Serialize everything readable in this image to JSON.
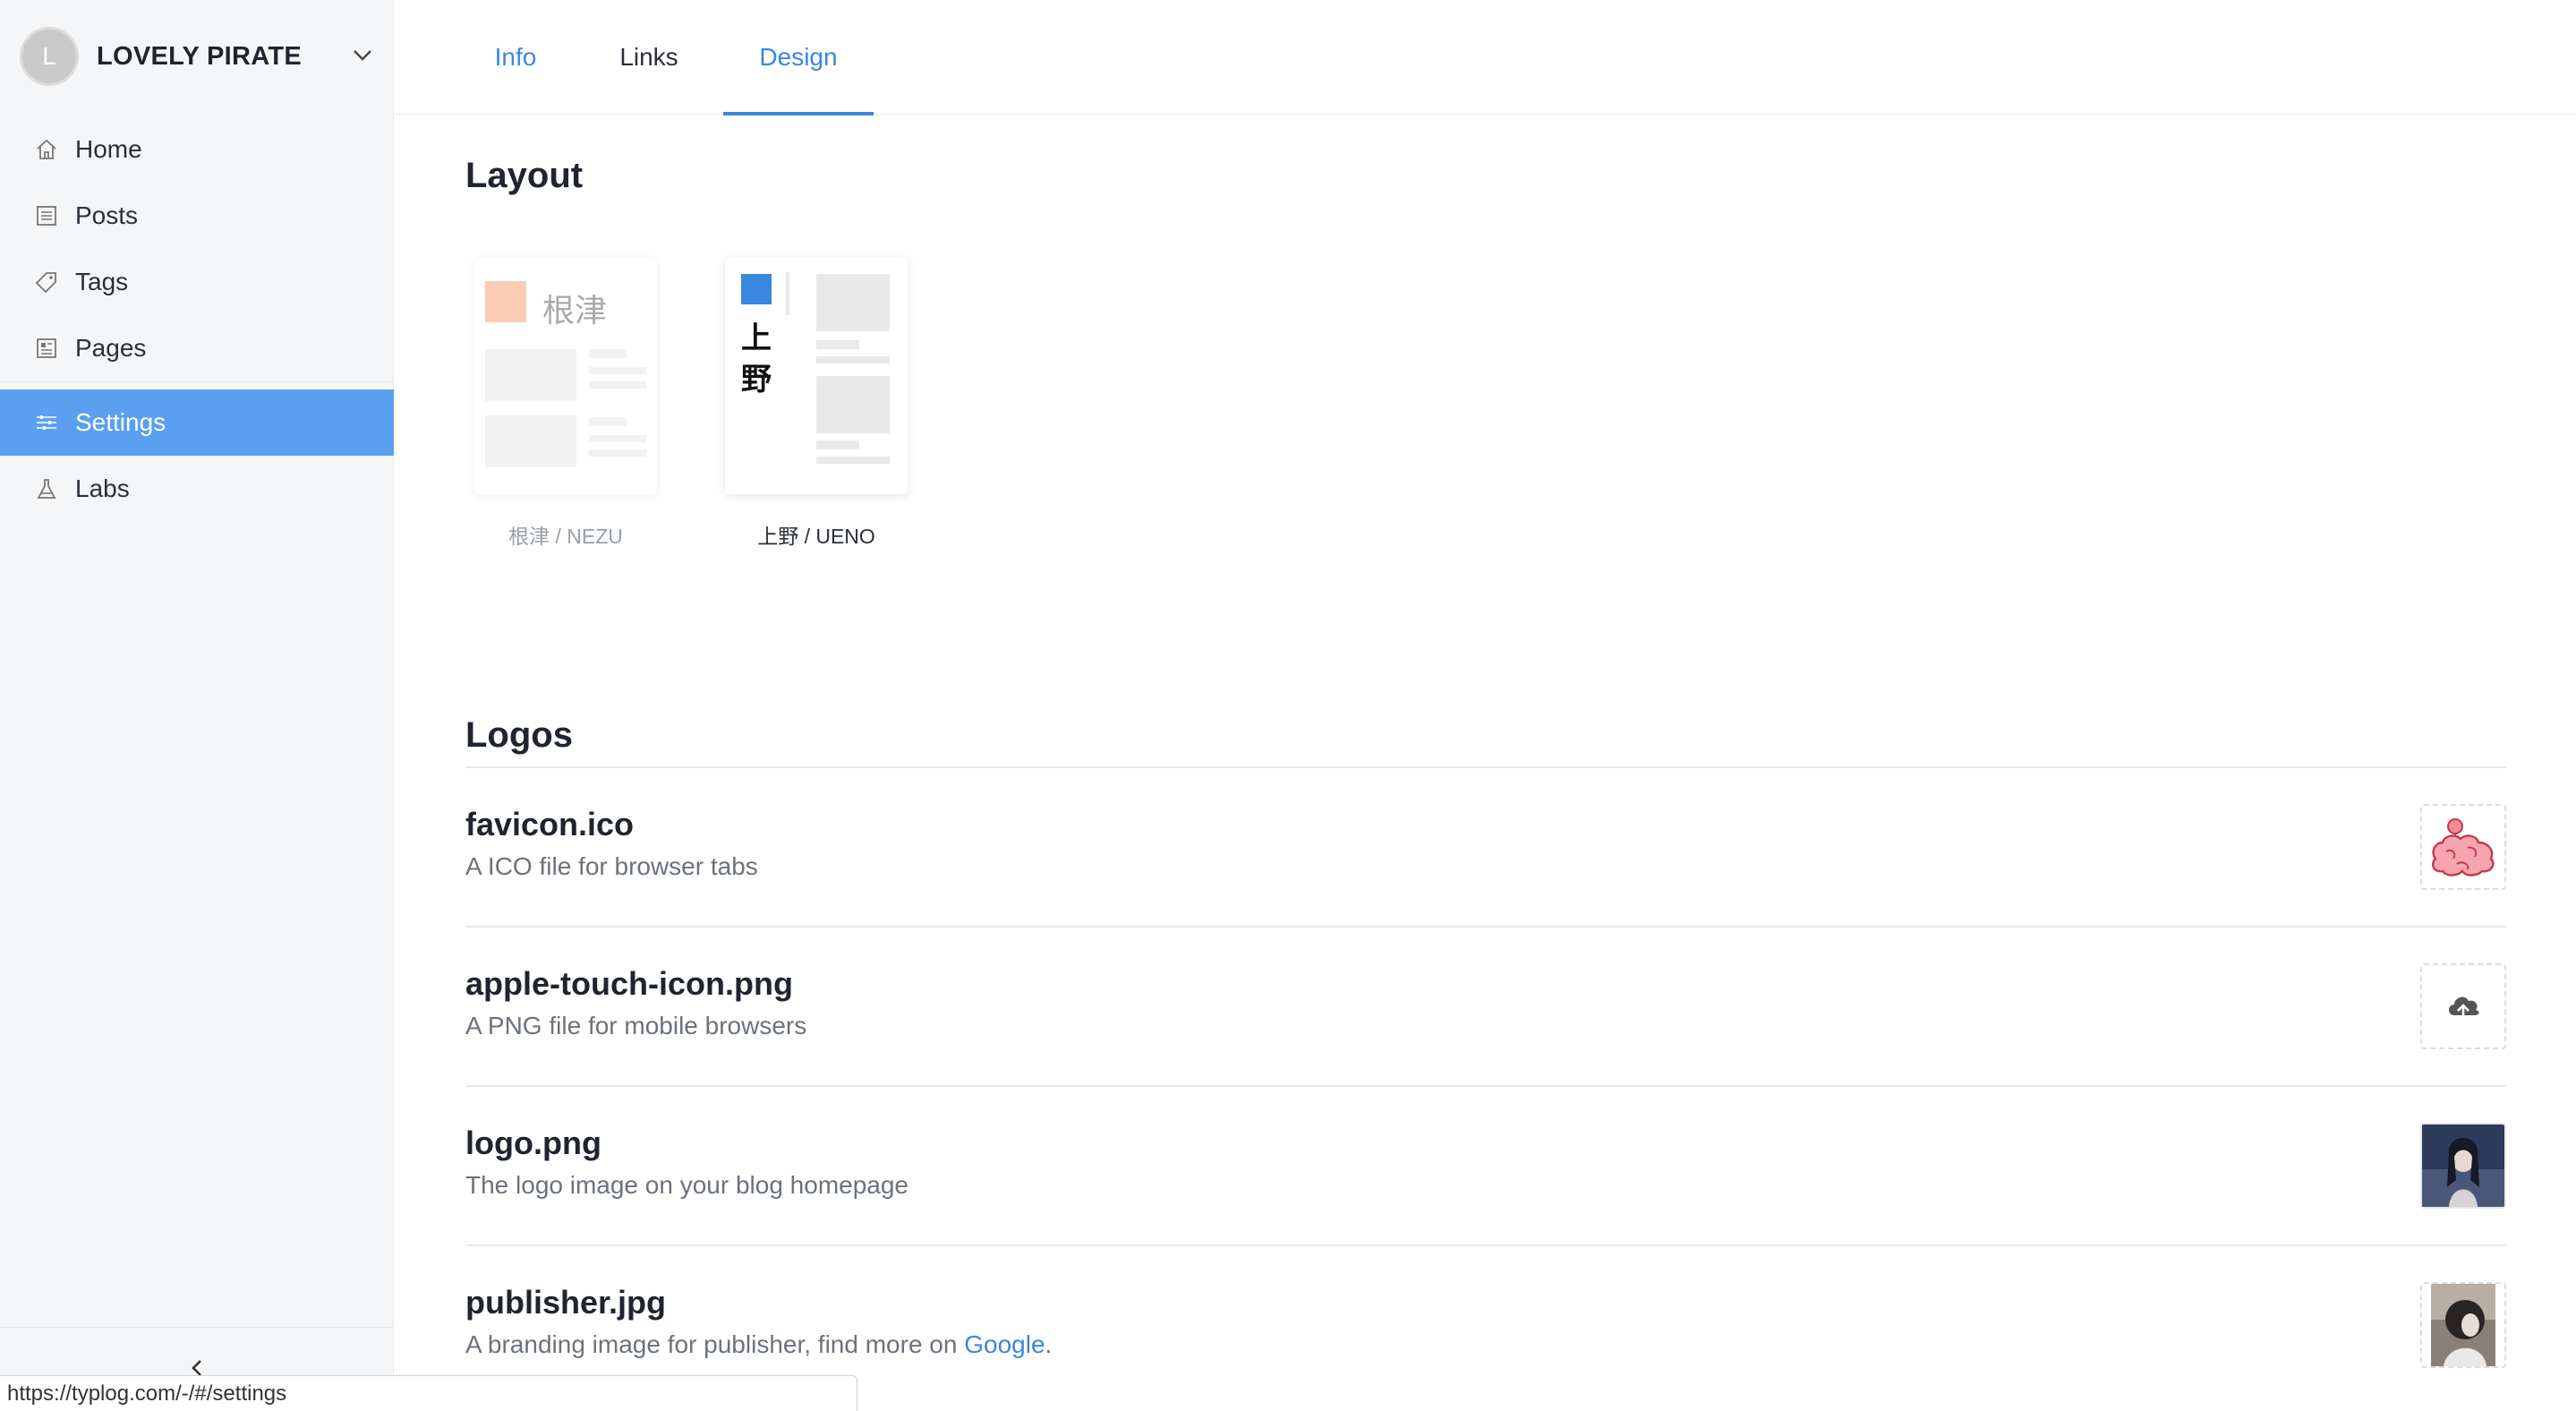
{
  "sidebar": {
    "avatar_letter": "L",
    "site_name": "LOVELY PIRATE",
    "items": [
      {
        "label": "Home",
        "icon": "home-icon"
      },
      {
        "label": "Posts",
        "icon": "posts-icon"
      },
      {
        "label": "Tags",
        "icon": "tag-icon"
      },
      {
        "label": "Pages",
        "icon": "pages-icon"
      },
      {
        "label": "Settings",
        "icon": "sliders-icon",
        "active": true
      },
      {
        "label": "Labs",
        "icon": "flask-icon"
      }
    ]
  },
  "tabs": [
    {
      "label": "Info"
    },
    {
      "label": "Links"
    },
    {
      "label": "Design",
      "active": true
    }
  ],
  "layout": {
    "title": "Layout",
    "options": [
      {
        "thumb_text": "根津",
        "caption": "根津 / NEZU",
        "selected": false
      },
      {
        "thumb_text_1": "上",
        "thumb_text_2": "野",
        "caption": "上野 / UENO",
        "selected": true
      }
    ]
  },
  "logos": {
    "title": "Logos",
    "items": [
      {
        "name": "favicon.ico",
        "desc": "A ICO file for browser tabs",
        "thumb": "brain-icon"
      },
      {
        "name": "apple-touch-icon.png",
        "desc": "A PNG file for mobile browsers",
        "thumb": "cloud-upload-icon"
      },
      {
        "name": "logo.png",
        "desc": "The logo image on your blog homepage",
        "thumb": "logo-image"
      },
      {
        "name": "publisher.jpg",
        "desc_prefix": "A branding image for publisher, find more on ",
        "desc_link": "Google",
        "desc_suffix": ".",
        "thumb": "publisher-image"
      }
    ]
  },
  "status_url": "https://typlog.com/-/#/settings",
  "colors": {
    "accent": "#3a87e0",
    "active_nav_bg": "#5a9ff0",
    "sidebar_bg": "#f5f6f7"
  }
}
